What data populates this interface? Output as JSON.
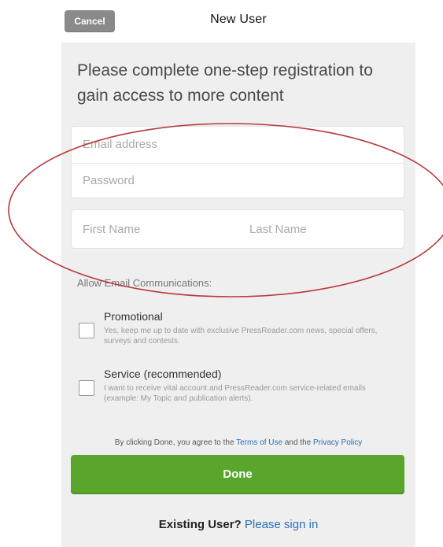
{
  "header": {
    "cancel_label": "Cancel",
    "title": "New User"
  },
  "intro_text": "Please complete one-step registration to gain access to more content",
  "form": {
    "email_placeholder": "Email address",
    "password_placeholder": "Password",
    "first_name_placeholder": "First Name",
    "last_name_placeholder": "Last Name"
  },
  "communications": {
    "label": "Allow Email Communications:",
    "options": [
      {
        "title": "Promotional",
        "description": "Yes, keep me up to date with exclusive PressReader.com news, special offers, surveys and contests.",
        "checked": false
      },
      {
        "title": "Service (recommended)",
        "description": "I want to receive vital account and PressReader.com service-related emails (example: My Topic and publication alerts).",
        "checked": false
      }
    ]
  },
  "terms": {
    "prefix": "By clicking Done, you agree to the ",
    "terms_link": "Terms of Use",
    "middle": " and the ",
    "privacy_link": "Privacy Policy"
  },
  "done_label": "Done",
  "existing": {
    "prompt": "Existing User?",
    "link": "Please sign in"
  },
  "colors": {
    "done_green": "#5aa52c",
    "link_blue": "#2a6fb8",
    "annotation_red": "#b83a3a"
  }
}
